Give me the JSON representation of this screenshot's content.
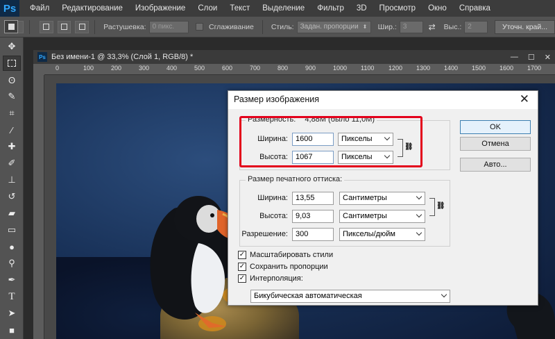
{
  "app": {
    "logo": "Ps",
    "menu": [
      "Файл",
      "Редактирование",
      "Изображение",
      "Слои",
      "Текст",
      "Выделение",
      "Фильтр",
      "3D",
      "Просмотр",
      "Окно",
      "Справка"
    ]
  },
  "options": {
    "feather_label": "Растушевка:",
    "feather_value": "0 пикс.",
    "antialias_label": "Сглаживание",
    "style_label": "Стиль:",
    "style_value": "Задан. пропорции",
    "width_label": "Шир.:",
    "width_value": "3",
    "height_label": "Выс.:",
    "height_value": "2",
    "refine_button": "Уточн. край..."
  },
  "document": {
    "logo": "Ps",
    "title": "Без имени-1 @ 33,3% (Слой 1, RGB/8) *",
    "window_buttons": [
      "—",
      "☐",
      "✕"
    ],
    "ruler_ticks": [
      "0",
      "100",
      "200",
      "300",
      "400",
      "500",
      "600",
      "700",
      "800",
      "900",
      "1000",
      "1100",
      "1200",
      "1300",
      "1400",
      "1500",
      "1600",
      "1700"
    ]
  },
  "toolbar": {
    "icons": [
      "move-icon",
      "marquee-icon",
      "lasso-icon",
      "quick-select-icon",
      "crop-icon",
      "eyedropper-icon",
      "healing-icon",
      "brush-icon",
      "stamp-icon",
      "history-brush-icon",
      "eraser-icon",
      "gradient-icon",
      "blur-icon",
      "dodge-icon",
      "pen-icon",
      "type-icon",
      "path-select-icon",
      "shape-icon"
    ]
  },
  "dialog": {
    "title": "Размер изображения",
    "close": "✕",
    "pixel_group": {
      "legend": "Размерность:",
      "size_info": "4,88M (было 11,0M)",
      "width_label": "Ширина:",
      "width_value": "1600",
      "width_unit": "Пикселы",
      "height_label": "Высота:",
      "height_value": "1067",
      "height_unit": "Пикселы"
    },
    "print_group": {
      "legend": "Размер печатного оттиска:",
      "width_label": "Ширина:",
      "width_value": "13,55",
      "width_unit": "Сантиметры",
      "height_label": "Высота:",
      "height_value": "9,03",
      "height_unit": "Сантиметры",
      "resolution_label": "Разрешение:",
      "resolution_value": "300",
      "resolution_unit": "Пикселы/дюйм"
    },
    "buttons": {
      "ok": "OK",
      "cancel": "Отмена",
      "auto": "Авто..."
    },
    "checkboxes": {
      "scale_styles": "Масштабировать стили",
      "constrain": "Сохранить пропорции",
      "resample": "Интерполяция:"
    },
    "interpolation_value": "Бикубическая автоматическая",
    "check_mark": "✓",
    "chain": "⛓"
  }
}
